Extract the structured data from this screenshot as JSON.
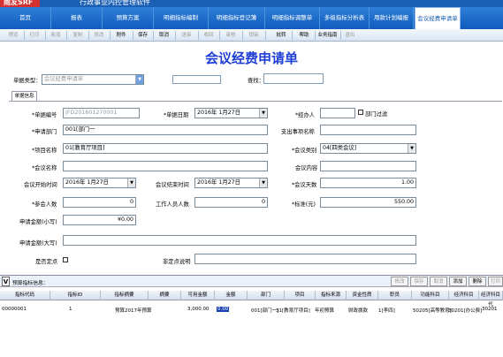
{
  "app": {
    "logo": "雨友SRF",
    "title": "行政事业内控管理软件"
  },
  "nav": [
    "首页",
    "报表",
    "预算方案",
    "明细指标编制",
    "明细指标登记簿",
    "明细指标调整单",
    "多级指标分析表",
    "用款计划编报",
    "会议经费申请单"
  ],
  "toolbar": [
    "预览",
    "打印",
    "新增",
    "复制",
    "修改",
    "附件",
    "保存",
    "取消",
    "送审",
    "收回",
    "审核",
    "销审",
    "批转",
    "帮助",
    "业务指南",
    "退出"
  ],
  "toolbar_active": [
    false,
    false,
    false,
    false,
    false,
    true,
    true,
    true,
    false,
    false,
    false,
    false,
    true,
    true,
    true,
    false
  ],
  "page_title": "会议经费申请单",
  "top": {
    "type_label": "单据类型：",
    "type_value": "会议经费申请单",
    "search_label": "查找：",
    "search_value": ""
  },
  "tab_label": "单据信息",
  "form": {
    "doc_no_label": "*单据编号",
    "doc_no": "JFD201601270001",
    "doc_date_label": "*单据日期",
    "doc_date": "2016年 1月27日",
    "handler_label": "*经办人",
    "handler": "",
    "dept_filter_label": "部门过滤",
    "dept_label": "*申请部门",
    "dept": "001[部门一",
    "expense_item_label": "支出事项名称",
    "expense_item": "",
    "project_label": "*项目名称",
    "project": "01[教育厅项目]",
    "meeting_type_label": "*会议类别",
    "meeting_type": "04[四类会议]",
    "meeting_name_label": "*会议名称",
    "meeting_name": "",
    "meeting_content_label": "会议内容",
    "meeting_content": "",
    "start_label": "会议开始时间",
    "start": "2016年 1月27日",
    "end_label": "会议结束时间",
    "end": "2016年 1月27日",
    "days_label": "*会议天数",
    "days": "1.00",
    "attendees_label": "*参会人数",
    "attendees": "0",
    "staff_label": "工作人员人数",
    "staff": "0",
    "standard_label": "*标准(元)",
    "standard": "550.00",
    "amount_small_label": "申请金额(小写)",
    "amount_small": "¥0.00",
    "amount_big_label": "申请金额(大写)",
    "amount_big": "",
    "fixed_point_label": "是否定点",
    "non_fixed_label": "非定点说明",
    "non_fixed": ""
  },
  "grid": {
    "label": "预算指标信息：",
    "buttons": [
      "修改",
      "保存",
      "取消",
      "添加",
      "删除",
      "打印"
    ],
    "buttons_active": [
      false,
      false,
      false,
      true,
      true,
      false
    ],
    "headers": [
      "指标代码",
      "指标ID",
      "指标摘要",
      "摘要",
      "可用金额",
      "金额",
      "部门",
      "项目",
      "指标来源",
      "资金性质",
      "职员",
      "功能科目",
      "经济科目",
      "经济科目代"
    ],
    "rows": [
      [
        "00000001",
        "1",
        "预算2017年预算",
        "",
        "3,000.00",
        "0.00",
        "001[部门一]",
        "31[教育厅项目]",
        "年初预算",
        "财政拨款",
        "1[李四]",
        "50205[高等教育]",
        "30201[办公费]",
        "30201"
      ]
    ]
  }
}
